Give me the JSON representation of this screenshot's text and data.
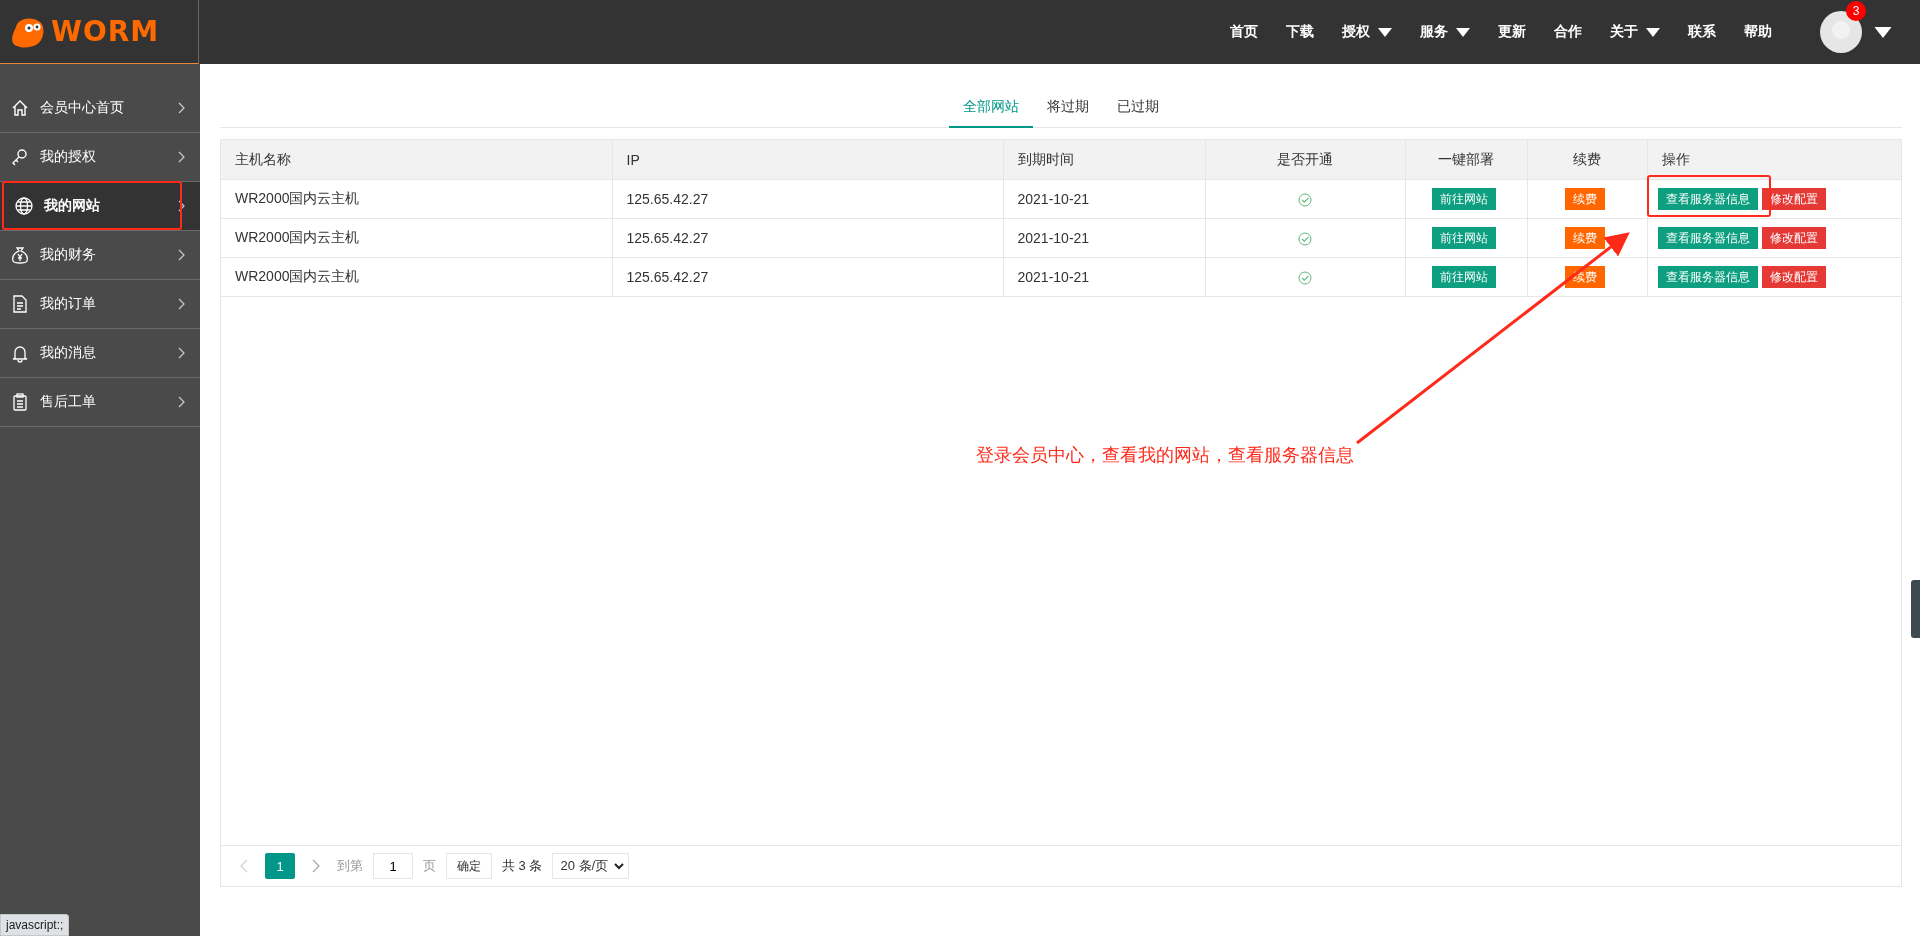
{
  "header": {
    "logo_text": "WORM",
    "nav": [
      {
        "label": "首页",
        "dropdown": false
      },
      {
        "label": "下载",
        "dropdown": false
      },
      {
        "label": "授权",
        "dropdown": true
      },
      {
        "label": "服务",
        "dropdown": true
      },
      {
        "label": "更新",
        "dropdown": false
      },
      {
        "label": "合作",
        "dropdown": false
      },
      {
        "label": "关于",
        "dropdown": true
      },
      {
        "label": "联系",
        "dropdown": false
      },
      {
        "label": "帮助",
        "dropdown": false
      }
    ],
    "notification_count": "3"
  },
  "sidebar": {
    "items": [
      {
        "label": "会员中心首页",
        "selected": false,
        "highlighted": false
      },
      {
        "label": "我的授权",
        "selected": false,
        "highlighted": false
      },
      {
        "label": "我的网站",
        "selected": true,
        "highlighted": true
      },
      {
        "label": "我的财务",
        "selected": false,
        "highlighted": false
      },
      {
        "label": "我的订单",
        "selected": false,
        "highlighted": false
      },
      {
        "label": "我的消息",
        "selected": false,
        "highlighted": false
      },
      {
        "label": "售后工单",
        "selected": false,
        "highlighted": false
      }
    ]
  },
  "tabs": [
    {
      "label": "全部网站",
      "selected": true
    },
    {
      "label": "将过期",
      "selected": false
    },
    {
      "label": "已过期",
      "selected": false
    }
  ],
  "table": {
    "columns": [
      "主机名称",
      "IP",
      "到期时间",
      "是否开通",
      "一键部署",
      "续费",
      "操作"
    ],
    "rows": [
      {
        "name": "WR2000国内云主机",
        "ip": "125.65.42.27",
        "expires": "2021-10-21",
        "active": true,
        "deploy": "前往网站",
        "renew": "续费",
        "view": "查看服务器信息",
        "modify": "修改配置",
        "highlighted": true
      },
      {
        "name": "WR2000国内云主机",
        "ip": "125.65.42.27",
        "expires": "2021-10-21",
        "active": true,
        "deploy": "前往网站",
        "renew": "续费",
        "view": "查看服务器信息",
        "modify": "修改配置",
        "highlighted": false
      },
      {
        "name": "WR2000国内云主机",
        "ip": "125.65.42.27",
        "expires": "2021-10-21",
        "active": true,
        "deploy": "前往网站",
        "renew": "续费",
        "view": "查看服务器信息",
        "modify": "修改配置",
        "highlighted": false
      }
    ]
  },
  "pagination": {
    "prev_disabled": true,
    "pages": [
      {
        "label": "1",
        "selected": true
      }
    ],
    "goto_label": "到第",
    "goto_value": "1",
    "page_unit": "页",
    "confirm": "确定",
    "total": "共 3 条",
    "page_size": "20 条/页"
  },
  "annotation": {
    "text": "登录会员中心，查看我的网站，查看服务器信息"
  },
  "status_bar": "javascript:;"
}
